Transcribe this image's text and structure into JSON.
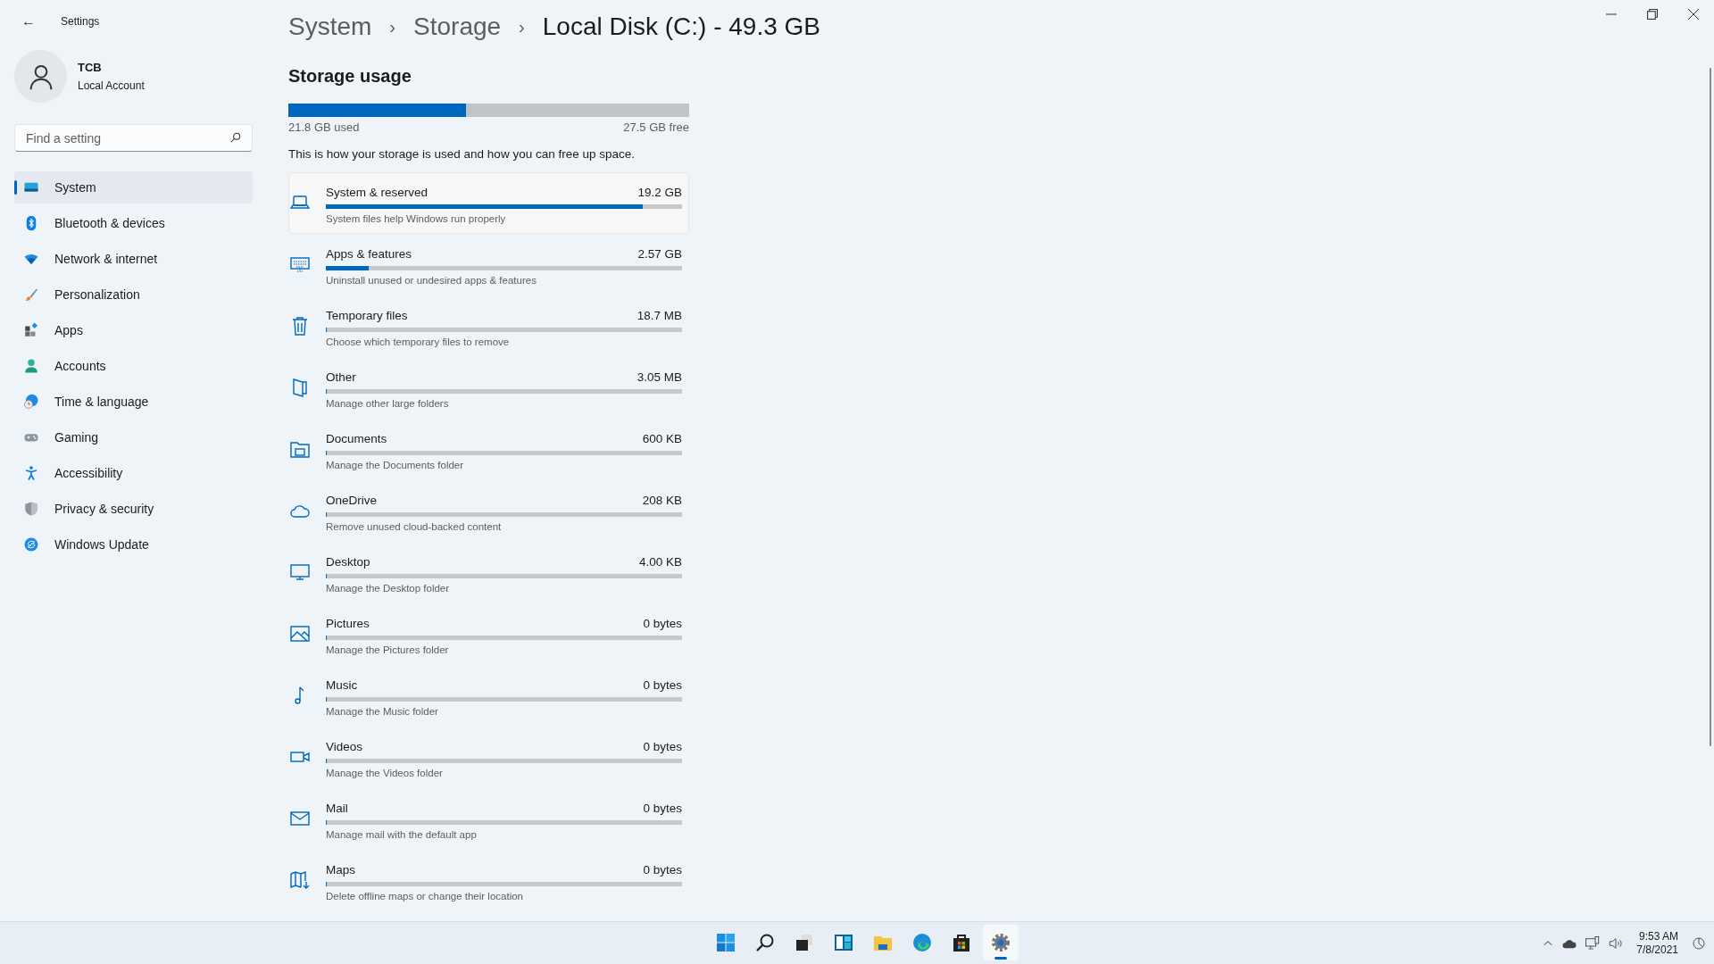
{
  "window": {
    "title": "Settings",
    "back": "←"
  },
  "account": {
    "name": "TCB",
    "type": "Local Account"
  },
  "search": {
    "placeholder": "Find a setting"
  },
  "sidebar": {
    "items": [
      {
        "label": "System",
        "kind": "system",
        "selected": true
      },
      {
        "label": "Bluetooth & devices",
        "kind": "bluetooth",
        "selected": false
      },
      {
        "label": "Network & internet",
        "kind": "wifi",
        "selected": false
      },
      {
        "label": "Personalization",
        "kind": "brush",
        "selected": false
      },
      {
        "label": "Apps",
        "kind": "apps",
        "selected": false
      },
      {
        "label": "Accounts",
        "kind": "person",
        "selected": false
      },
      {
        "label": "Time & language",
        "kind": "globe",
        "selected": false
      },
      {
        "label": "Gaming",
        "kind": "gamepad",
        "selected": false
      },
      {
        "label": "Accessibility",
        "kind": "accessibility",
        "selected": false
      },
      {
        "label": "Privacy & security",
        "kind": "shield",
        "selected": false
      },
      {
        "label": "Windows Update",
        "kind": "update",
        "selected": false
      }
    ]
  },
  "breadcrumb": {
    "items": [
      "System",
      "Storage",
      "Local Disk (C:) - 49.3 GB"
    ],
    "separator": "›"
  },
  "storage_usage": {
    "heading": "Storage usage",
    "level": 0.443,
    "used": "21.8 GB used",
    "free": "27.5 GB free",
    "description": "This is how your storage is used and how you can free up space."
  },
  "categories": [
    {
      "kind": "laptop",
      "name": "System & reserved",
      "size": "19.2 GB",
      "description": "System files help Windows run properly",
      "level": 0.89,
      "highlighted": true
    },
    {
      "kind": "keyboard",
      "name": "Apps & features",
      "size": "2.57 GB",
      "description": "Uninstall unused or undesired apps & features",
      "level": 0.12,
      "highlighted": false
    },
    {
      "kind": "trash",
      "name": "Temporary files",
      "size": "18.7 MB",
      "description": "Choose which temporary files to remove",
      "level": 0,
      "highlighted": false
    },
    {
      "kind": "folder-tall",
      "name": "Other",
      "size": "3.05 MB",
      "description": "Manage other large folders",
      "level": 0,
      "highlighted": false
    },
    {
      "kind": "documents",
      "name": "Documents",
      "size": "600 KB",
      "description": "Manage the Documents folder",
      "level": 0,
      "highlighted": false
    },
    {
      "kind": "cloud",
      "name": "OneDrive",
      "size": "208 KB",
      "description": "Remove unused cloud-backed content",
      "level": 0,
      "highlighted": false
    },
    {
      "kind": "monitor",
      "name": "Desktop",
      "size": "4.00 KB",
      "description": "Manage the Desktop folder",
      "level": 0,
      "highlighted": false
    },
    {
      "kind": "picture",
      "name": "Pictures",
      "size": "0 bytes",
      "description": "Manage the Pictures folder",
      "level": 0,
      "highlighted": false
    },
    {
      "kind": "music",
      "name": "Music",
      "size": "0 bytes",
      "description": "Manage the Music folder",
      "level": 0,
      "highlighted": false
    },
    {
      "kind": "video",
      "name": "Videos",
      "size": "0 bytes",
      "description": "Manage the Videos folder",
      "level": 0,
      "highlighted": false
    },
    {
      "kind": "mail",
      "name": "Mail",
      "size": "0 bytes",
      "description": "Manage mail with the default app",
      "level": 0,
      "highlighted": false
    },
    {
      "kind": "map",
      "name": "Maps",
      "size": "0 bytes",
      "description": "Delete offline maps or change their location",
      "level": 0,
      "highlighted": false
    }
  ],
  "taskbar": {
    "apps": [
      {
        "kind": "start",
        "active": false
      },
      {
        "kind": "search",
        "active": false
      },
      {
        "kind": "taskview",
        "active": false
      },
      {
        "kind": "widgets",
        "active": false
      },
      {
        "kind": "explorer",
        "active": false
      },
      {
        "kind": "edge",
        "active": false
      },
      {
        "kind": "store",
        "active": false
      },
      {
        "kind": "settings",
        "active": true
      }
    ],
    "time": "9:53 AM",
    "date": "7/8/2021"
  }
}
